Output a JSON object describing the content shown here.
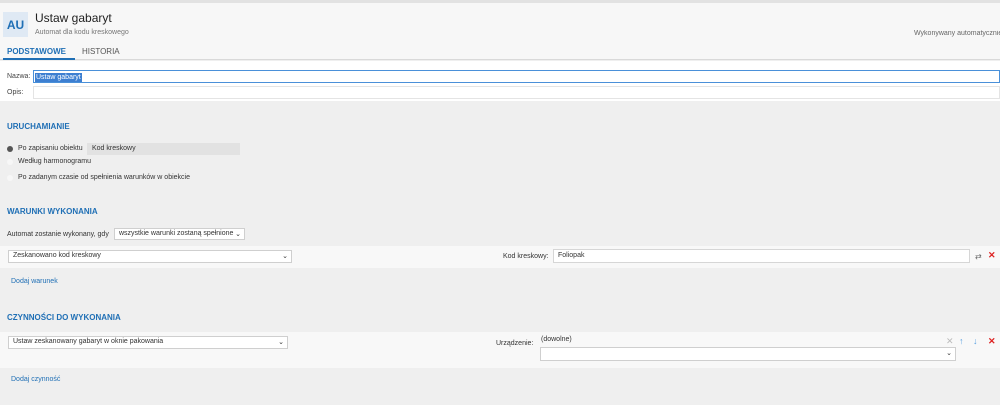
{
  "header": {
    "avatar_initials": "AU",
    "title": "Ustaw gabaryt",
    "subtitle": "Automat dla kodu kreskowego",
    "status": "Wykonywany automatycznie"
  },
  "tabs": [
    {
      "label": "PODSTAWOWE",
      "active": true
    },
    {
      "label": "HISTORIA",
      "active": false
    }
  ],
  "form": {
    "name_label": "Nazwa:",
    "name_value": "Ustaw gabaryt",
    "desc_label": "Opis:",
    "desc_value": ""
  },
  "launch": {
    "title": "URUCHAMIANIE",
    "options": [
      {
        "label": "Po zapisaniu obiektu",
        "checked": true
      },
      {
        "label": "Według harmonogramu",
        "checked": false
      },
      {
        "label": "Po zadanym czasie od spełnienia warunków w obiekcie",
        "checked": false
      }
    ],
    "object_value": "Kod kreskowy"
  },
  "conditions": {
    "title": "WARUNKI WYKONANIA",
    "rule_label": "Automat zostanie wykonany, gdy",
    "rule_value": "wszystkie warunki zostaną spełnione",
    "condition_type": "Zeskanowano kod kreskowy",
    "field_label": "Kod kreskowy:",
    "field_value": "Foliopak",
    "add_link": "Dodaj warunek"
  },
  "actions": {
    "title": "CZYNNOŚCI DO WYKONANIA",
    "action_type": "Ustaw zeskanowany gabaryt w oknie pakowania",
    "device_label": "Urządzenie:",
    "device_value": "(dowolne)",
    "add_link": "Dodaj czynność"
  },
  "colors": {
    "accent": "#1f6fb5",
    "delete": "#dd2222",
    "selection": "#3d7fd1"
  }
}
